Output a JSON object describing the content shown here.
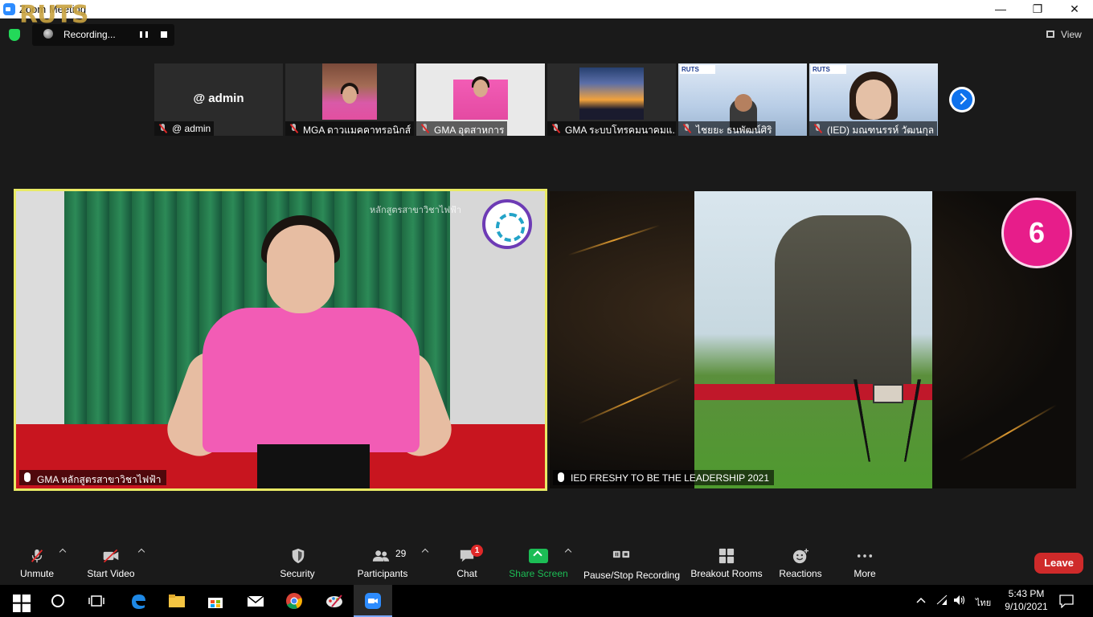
{
  "window": {
    "title": "Zoom Meeting",
    "min": "—",
    "max": "❐",
    "close": "✕"
  },
  "topbar": {
    "recording_label": "Recording...",
    "recording_logo": "RUTS",
    "view_label": "View"
  },
  "thumbnails": [
    {
      "name": "@ admin",
      "center_text": "@ admin",
      "kind": "avatar"
    },
    {
      "name": "MGA ดาวแมคคาทรอนิกส์",
      "kind": "pink"
    },
    {
      "name": "GMA อุตสาหการ",
      "kind": "pink2"
    },
    {
      "name": "GMA ระบบโทรคมนาคมแ...",
      "kind": "sunset"
    },
    {
      "name": "ไชยยะ ธนพัฒน์ศิริ",
      "kind": "office",
      "logo": "RUTS"
    },
    {
      "name": "(IED) มณฑนรรห์ วัฒนกุล",
      "kind": "office2",
      "logo": "RUTS"
    }
  ],
  "tiles": {
    "left": {
      "name": "GMA หลักสูตรสาขาวิชาไฟฟ้า",
      "watermark": "หลักสูตรสาขาวิชาไฟฟ้า"
    },
    "right": {
      "name": "IED FRESHY TO BE THE LEADERSHIP 2021",
      "badge": "6"
    }
  },
  "toolbar": {
    "unmute": "Unmute",
    "start_video": "Start Video",
    "security": "Security",
    "participants": "Participants",
    "participants_count": "29",
    "chat": "Chat",
    "chat_badge": "1",
    "share_screen": "Share Screen",
    "pause_stop_recording": "Pause/Stop Recording",
    "breakout_rooms": "Breakout Rooms",
    "reactions": "Reactions",
    "more": "More",
    "leave": "Leave"
  },
  "taskbar": {
    "time": "5:43 PM",
    "date": "9/10/2021",
    "lang": "ไทย"
  },
  "colors": {
    "share_green": "#1cbd55",
    "leave_red": "#cf2a2a",
    "active_speaker": "#e9ea65",
    "badge_pink": "#e71d8a"
  }
}
